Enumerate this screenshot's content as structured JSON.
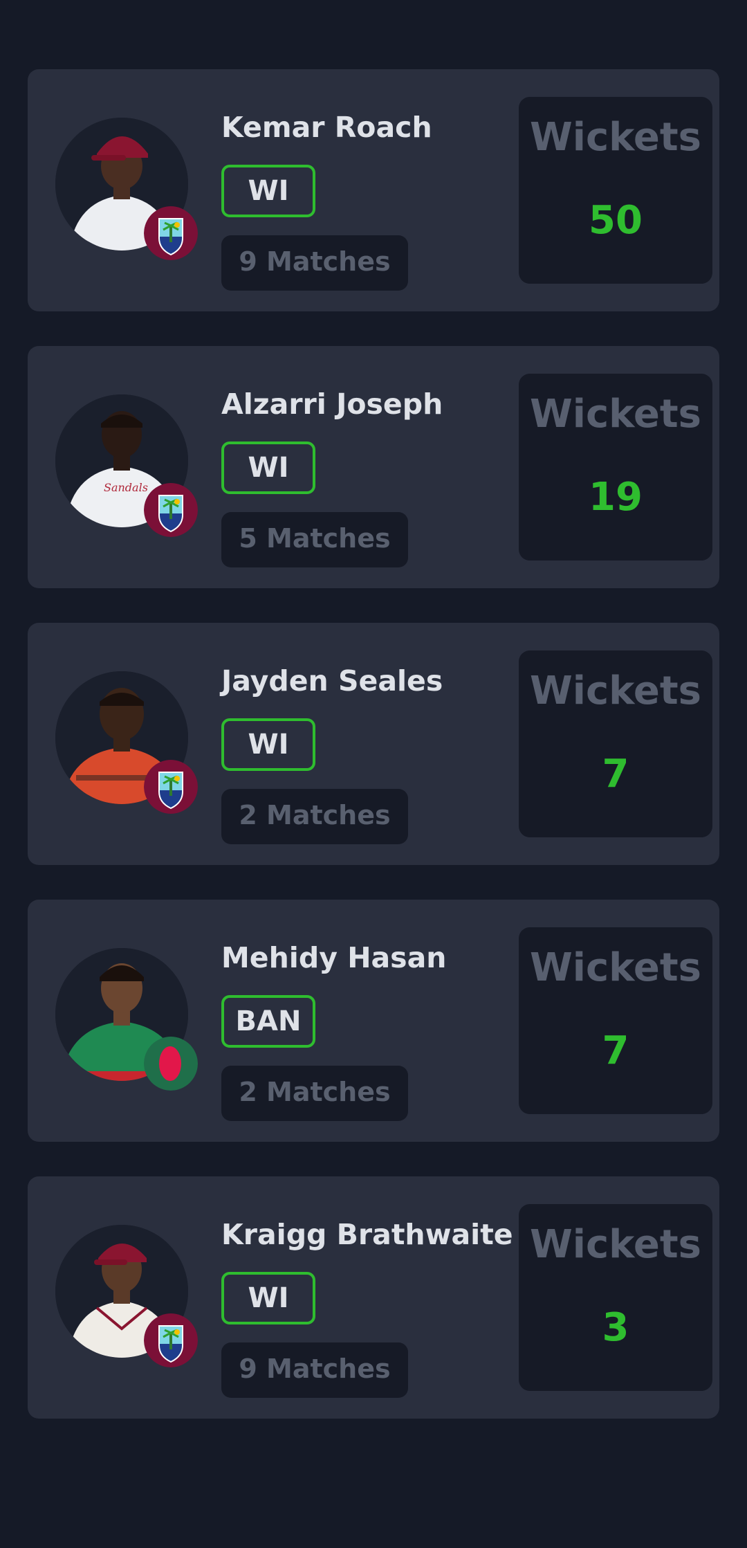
{
  "stat_label": "Wickets",
  "colors": {
    "background": "#151a27",
    "card": "#2a2f3e",
    "panel": "#161a26",
    "accent_green": "#2fbd2f",
    "muted_text": "#585f6f",
    "primary_text": "#dfe2e8"
  },
  "players": [
    {
      "name": "Kemar Roach",
      "team": "WI",
      "matches": "9 Matches",
      "wickets": "50",
      "flag": "west-indies-flag-icon",
      "avatar": "player-photo"
    },
    {
      "name": "Alzarri Joseph",
      "team": "WI",
      "matches": "5 Matches",
      "wickets": "19",
      "flag": "west-indies-flag-icon",
      "avatar": "player-photo"
    },
    {
      "name": "Jayden Seales",
      "team": "WI",
      "matches": "2 Matches",
      "wickets": "7",
      "flag": "west-indies-flag-icon",
      "avatar": "player-photo"
    },
    {
      "name": "Mehidy Hasan",
      "team": "BAN",
      "matches": "2 Matches",
      "wickets": "7",
      "flag": "bangladesh-flag-icon",
      "avatar": "player-photo"
    },
    {
      "name": "Kraigg Brathwaite",
      "team": "WI",
      "matches": "9 Matches",
      "wickets": "3",
      "flag": "west-indies-flag-icon",
      "avatar": "player-photo"
    }
  ]
}
